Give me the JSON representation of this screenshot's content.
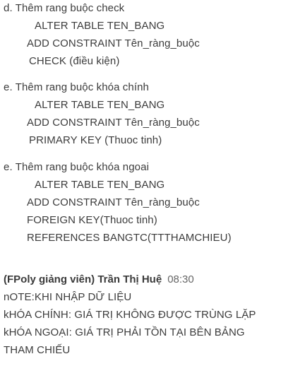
{
  "sections": [
    {
      "heading": "d. Thêm rang buộc check",
      "lines": [
        "ALTER TABLE TEN_BANG",
        "ADD CONSTRAINT Tên_ràng_buộc",
        "CHECK (điều kiện)"
      ]
    },
    {
      "heading": "e. Thêm rang buộc khóa chính",
      "lines": [
        "ALTER TABLE TEN_BANG",
        "ADD CONSTRAINT Tên_ràng_buộc",
        "PRIMARY KEY (Thuoc tinh)"
      ]
    },
    {
      "heading": "e. Thêm rang buộc khóa ngoai",
      "lines": [
        "ALTER TABLE TEN_BANG",
        "ADD CONSTRAINT Tên_ràng_buộc",
        "FOREIGN KEY(Thuoc tinh)",
        "REFERENCES BANGTC(TTTHAMCHIEU)"
      ]
    }
  ],
  "message": {
    "author": "(FPoly giảng viên) Trần Thị Huệ",
    "time": "08:30",
    "lines": [
      "nOTE:KHI NHẬP DỮ LIỆU",
      "kHÓA CHÍNH: GIÁ TRỊ KHÔNG ĐƯỢC TRÙNG LẶP",
      "kHÓA NGOẠI: GIÁ TRỊ PHẢI TỒN TẠI BÊN BẢNG",
      "THAM CHIẾU"
    ]
  }
}
